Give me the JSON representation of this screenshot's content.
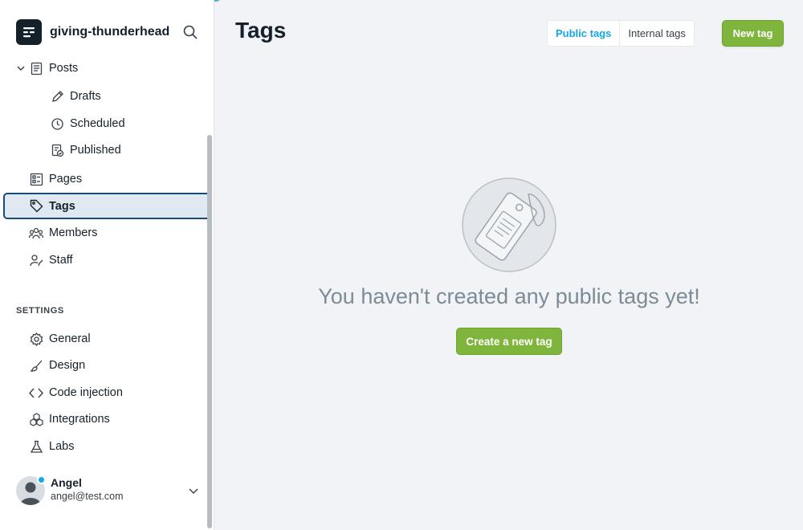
{
  "brand": {
    "name": "giving-thunderhead"
  },
  "nav": {
    "posts": "Posts",
    "drafts": "Drafts",
    "scheduled": "Scheduled",
    "published": "Published",
    "pages": "Pages",
    "tags": "Tags",
    "members": "Members",
    "staff": "Staff"
  },
  "settings": {
    "title": "SETTINGS",
    "general": "General",
    "design": "Design",
    "code_injection": "Code injection",
    "integrations": "Integrations",
    "labs": "Labs"
  },
  "user": {
    "name": "Angel",
    "email": "angel@test.com"
  },
  "main": {
    "title": "Tags",
    "public_tab": "Public tags",
    "internal_tab": "Internal tags",
    "new_tag": "New tag",
    "empty_message": "You haven't created any public tags yet!",
    "create_button": "Create a new tag"
  },
  "colors": {
    "accent": "#14a6e9",
    "primary_button": "#7fb53c",
    "active_border": "#1a4a7a"
  }
}
